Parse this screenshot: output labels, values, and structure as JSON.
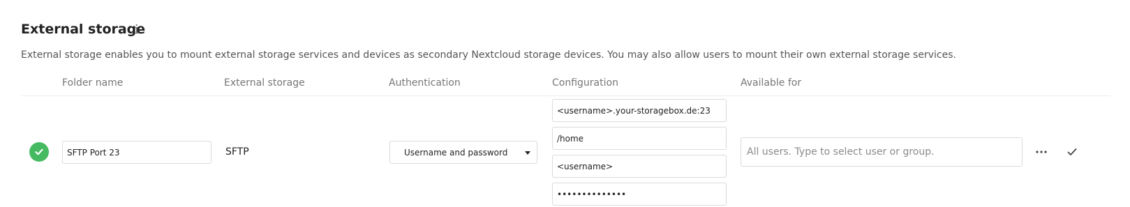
{
  "section": {
    "title": "External storage",
    "info_icon": "info-icon",
    "description": "External storage enables you to mount external storage services and devices as secondary Nextcloud storage devices. You may also allow users to mount their own external storage services."
  },
  "table": {
    "headers": {
      "folder_name": "Folder name",
      "external_storage": "External storage",
      "authentication": "Authentication",
      "configuration": "Configuration",
      "available_for": "Available for"
    },
    "rows": [
      {
        "status": "ok",
        "status_icon": "checkmark-circle-icon",
        "status_color": "#46ba61",
        "folder_name": "SFTP Port 23",
        "backend": "SFTP",
        "authentication": "Username and password",
        "configuration": {
          "host": "<username>.your-storagebox.de:23",
          "root": "/home",
          "user": "<username>",
          "password": "••••••••••••••"
        },
        "applicable_placeholder": "All users. Type to select user or group.",
        "actions": {
          "more_icon": "more-horizontal-icon",
          "save_icon": "checkmark-icon"
        }
      }
    ]
  }
}
